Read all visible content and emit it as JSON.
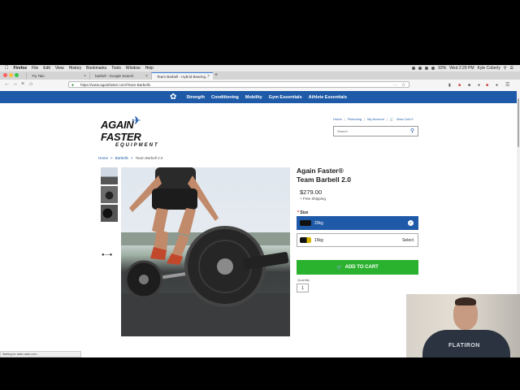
{
  "os_menu": {
    "app": "Firefox",
    "items": [
      "File",
      "Edit",
      "View",
      "History",
      "Bookmarks",
      "Tools",
      "Window",
      "Help"
    ],
    "battery": "93%",
    "clock": "Wed 2:29 PM",
    "user": "Kyle Coberly"
  },
  "tabs": [
    {
      "label": "Try Talo"
    },
    {
      "label": "barbell - Google Search"
    },
    {
      "label": "Team Barbell - Hybrid Bearing..."
    }
  ],
  "browser": {
    "url": "https://www.againfaster.com/Team-Barbells"
  },
  "site": {
    "nav": [
      "Strength",
      "Conditioning",
      "Mobility",
      "Gym Essentials",
      "Athlete Essentials"
    ],
    "brand_name": "AGAIN FASTER",
    "brand_sub": "EQUIPMENT",
    "top_links": {
      "home": "Home",
      "financing": "Financing",
      "account": "My Account",
      "cart": "View Cart 0"
    },
    "search_placeholder": "Search",
    "breadcrumb": {
      "home": "Home",
      "category": "Barbells",
      "current": "Team Barbell 2.0"
    },
    "product": {
      "title_line1": "Again Faster®",
      "title_line2": "Team Barbell 2.0",
      "price": "$279.00",
      "shipping": "+ Free Shipping",
      "size_label": "Size",
      "size_required": "*",
      "options": [
        {
          "label": "20kg",
          "selected": true
        },
        {
          "label": "15kg",
          "action": "Select",
          "selected": false
        }
      ],
      "add_to_cart": "ADD TO CART",
      "quantity_label": "Quantity",
      "quantity": "1"
    }
  },
  "status_bar": "Waiting for static.olark.com...",
  "webcam": {
    "shirt_text": "FLATIRON"
  },
  "colors": {
    "brand_blue": "#1e5aa8",
    "cart_green": "#2ab12e"
  }
}
